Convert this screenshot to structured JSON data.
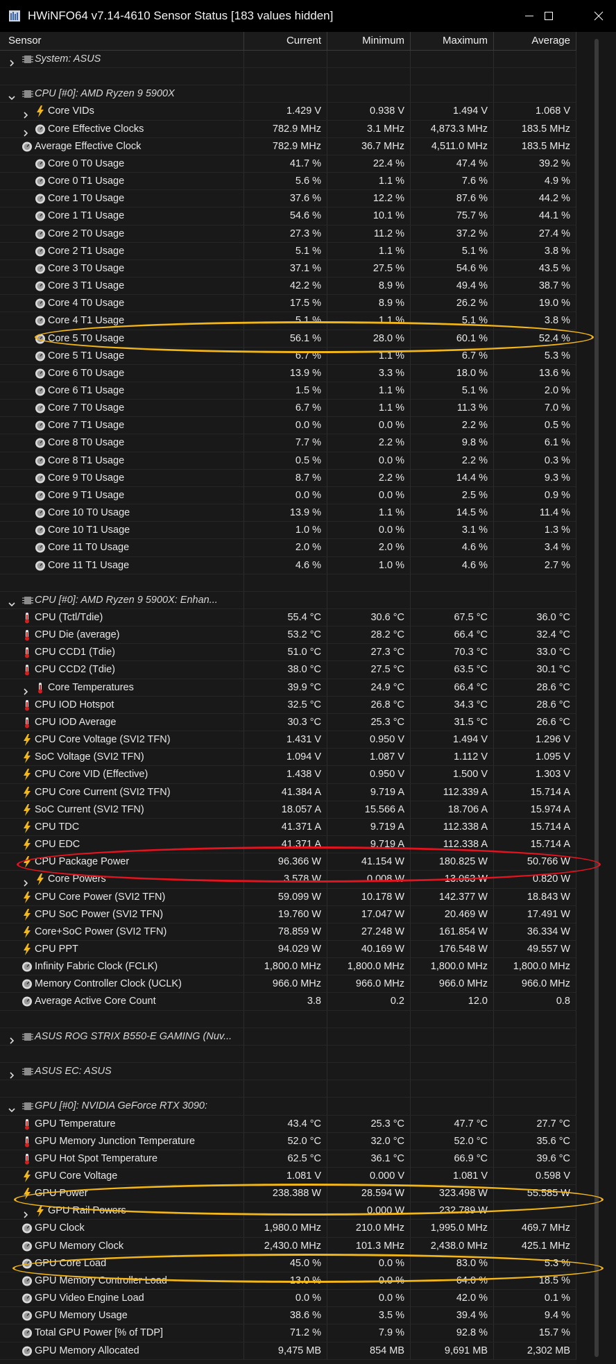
{
  "window": {
    "title": "HWiNFO64 v7.14-4610 Sensor Status [183 values hidden]"
  },
  "columns": {
    "sensor": "Sensor",
    "current": "Current",
    "minimum": "Minimum",
    "maximum": "Maximum",
    "average": "Average"
  },
  "colors": {
    "highlight_yellow": "#f2b61a",
    "highlight_red": "#e3141f"
  },
  "rows": [
    {
      "type": "group",
      "name": "System: ASUS",
      "icon": "chip-icon",
      "expander": "collapsed"
    },
    {
      "type": "spacer"
    },
    {
      "type": "group",
      "name": "CPU [#0]: AMD Ryzen 9 5900X",
      "icon": "chip-icon",
      "expander": "expanded"
    },
    {
      "type": "item",
      "indent": 1,
      "expander": "collapsed",
      "icon": "bolt-icon",
      "name": "Core VIDs",
      "current": "1.429 V",
      "minimum": "0.938 V",
      "maximum": "1.494 V",
      "average": "1.068 V"
    },
    {
      "type": "item",
      "indent": 1,
      "expander": "collapsed",
      "icon": "gauge-icon",
      "name": "Core Effective Clocks",
      "current": "782.9 MHz",
      "minimum": "3.1 MHz",
      "maximum": "4,873.3 MHz",
      "average": "183.5 MHz"
    },
    {
      "type": "item",
      "indent": 0,
      "icon": "gauge-icon",
      "name": "Average Effective Clock",
      "current": "782.9 MHz",
      "minimum": "36.7 MHz",
      "maximum": "4,511.0 MHz",
      "average": "183.5 MHz"
    },
    {
      "type": "item",
      "indent": 1,
      "icon": "gauge-icon",
      "name": "Core 0 T0 Usage",
      "current": "41.7 %",
      "minimum": "22.4 %",
      "maximum": "47.4 %",
      "average": "39.2 %"
    },
    {
      "type": "item",
      "indent": 1,
      "icon": "gauge-icon",
      "name": "Core 0 T1 Usage",
      "current": "5.6 %",
      "minimum": "1.1 %",
      "maximum": "7.6 %",
      "average": "4.9 %"
    },
    {
      "type": "item",
      "indent": 1,
      "icon": "gauge-icon",
      "name": "Core 1 T0 Usage",
      "current": "37.6 %",
      "minimum": "12.2 %",
      "maximum": "87.6 %",
      "average": "44.2 %"
    },
    {
      "type": "item",
      "indent": 1,
      "icon": "gauge-icon",
      "name": "Core 1 T1 Usage",
      "current": "54.6 %",
      "minimum": "10.1 %",
      "maximum": "75.7 %",
      "average": "44.1 %"
    },
    {
      "type": "item",
      "indent": 1,
      "icon": "gauge-icon",
      "name": "Core 2 T0 Usage",
      "current": "27.3 %",
      "minimum": "11.2 %",
      "maximum": "37.2 %",
      "average": "27.4 %"
    },
    {
      "type": "item",
      "indent": 1,
      "icon": "gauge-icon",
      "name": "Core 2 T1 Usage",
      "current": "5.1 %",
      "minimum": "1.1 %",
      "maximum": "5.1 %",
      "average": "3.8 %"
    },
    {
      "type": "item",
      "indent": 1,
      "icon": "gauge-icon",
      "name": "Core 3 T0 Usage",
      "current": "37.1 %",
      "minimum": "27.5 %",
      "maximum": "54.6 %",
      "average": "43.5 %"
    },
    {
      "type": "item",
      "indent": 1,
      "icon": "gauge-icon",
      "name": "Core 3 T1 Usage",
      "current": "42.2 %",
      "minimum": "8.9 %",
      "maximum": "49.4 %",
      "average": "38.7 %"
    },
    {
      "type": "item",
      "indent": 1,
      "icon": "gauge-icon",
      "name": "Core 4 T0 Usage",
      "current": "17.5 %",
      "minimum": "8.9 %",
      "maximum": "26.2 %",
      "average": "19.0 %"
    },
    {
      "type": "item",
      "indent": 1,
      "icon": "gauge-icon",
      "name": "Core 4 T1 Usage",
      "current": "5.1 %",
      "minimum": "1.1 %",
      "maximum": "5.1 %",
      "average": "3.8 %"
    },
    {
      "type": "item",
      "indent": 1,
      "icon": "gauge-icon",
      "name": "Core 5 T0 Usage",
      "current": "56.1 %",
      "minimum": "28.0 %",
      "maximum": "60.1 %",
      "average": "52.4 %"
    },
    {
      "type": "item",
      "indent": 1,
      "icon": "gauge-icon",
      "name": "Core 5 T1 Usage",
      "current": "6.7 %",
      "minimum": "1.1 %",
      "maximum": "6.7 %",
      "average": "5.3 %"
    },
    {
      "type": "item",
      "indent": 1,
      "icon": "gauge-icon",
      "name": "Core 6 T0 Usage",
      "current": "13.9 %",
      "minimum": "3.3 %",
      "maximum": "18.0 %",
      "average": "13.6 %"
    },
    {
      "type": "item",
      "indent": 1,
      "icon": "gauge-icon",
      "name": "Core 6 T1 Usage",
      "current": "1.5 %",
      "minimum": "1.1 %",
      "maximum": "5.1 %",
      "average": "2.0 %"
    },
    {
      "type": "item",
      "indent": 1,
      "icon": "gauge-icon",
      "name": "Core 7 T0 Usage",
      "current": "6.7 %",
      "minimum": "1.1 %",
      "maximum": "11.3 %",
      "average": "7.0 %"
    },
    {
      "type": "item",
      "indent": 1,
      "icon": "gauge-icon",
      "name": "Core 7 T1 Usage",
      "current": "0.0 %",
      "minimum": "0.0 %",
      "maximum": "2.2 %",
      "average": "0.5 %"
    },
    {
      "type": "item",
      "indent": 1,
      "icon": "gauge-icon",
      "name": "Core 8 T0 Usage",
      "current": "7.7 %",
      "minimum": "2.2 %",
      "maximum": "9.8 %",
      "average": "6.1 %"
    },
    {
      "type": "item",
      "indent": 1,
      "icon": "gauge-icon",
      "name": "Core 8 T1 Usage",
      "current": "0.5 %",
      "minimum": "0.0 %",
      "maximum": "2.2 %",
      "average": "0.3 %"
    },
    {
      "type": "item",
      "indent": 1,
      "icon": "gauge-icon",
      "name": "Core 9 T0 Usage",
      "current": "8.7 %",
      "minimum": "2.2 %",
      "maximum": "14.4 %",
      "average": "9.3 %"
    },
    {
      "type": "item",
      "indent": 1,
      "icon": "gauge-icon",
      "name": "Core 9 T1 Usage",
      "current": "0.0 %",
      "minimum": "0.0 %",
      "maximum": "2.5 %",
      "average": "0.9 %"
    },
    {
      "type": "item",
      "indent": 1,
      "icon": "gauge-icon",
      "name": "Core 10 T0 Usage",
      "current": "13.9 %",
      "minimum": "1.1 %",
      "maximum": "14.5 %",
      "average": "11.4 %"
    },
    {
      "type": "item",
      "indent": 1,
      "icon": "gauge-icon",
      "name": "Core 10 T1 Usage",
      "current": "1.0 %",
      "minimum": "0.0 %",
      "maximum": "3.1 %",
      "average": "1.3 %"
    },
    {
      "type": "item",
      "indent": 1,
      "icon": "gauge-icon",
      "name": "Core 11 T0 Usage",
      "current": "2.0 %",
      "minimum": "2.0 %",
      "maximum": "4.6 %",
      "average": "3.4 %"
    },
    {
      "type": "item",
      "indent": 1,
      "icon": "gauge-icon",
      "name": "Core 11 T1 Usage",
      "current": "4.6 %",
      "minimum": "1.0 %",
      "maximum": "4.6 %",
      "average": "2.7 %"
    },
    {
      "type": "spacer"
    },
    {
      "type": "group",
      "name": "CPU [#0]: AMD Ryzen 9 5900X: Enhan...",
      "icon": "chip-icon",
      "expander": "expanded"
    },
    {
      "type": "item",
      "indent": 0,
      "icon": "thermometer-icon",
      "name": "CPU (Tctl/Tdie)",
      "current": "55.4 °C",
      "minimum": "30.6 °C",
      "maximum": "67.5 °C",
      "average": "36.0 °C"
    },
    {
      "type": "item",
      "indent": 0,
      "icon": "thermometer-icon",
      "name": "CPU Die (average)",
      "current": "53.2 °C",
      "minimum": "28.2 °C",
      "maximum": "66.4 °C",
      "average": "32.4 °C"
    },
    {
      "type": "item",
      "indent": 0,
      "icon": "thermometer-icon",
      "name": "CPU CCD1 (Tdie)",
      "current": "51.0 °C",
      "minimum": "27.3 °C",
      "maximum": "70.3 °C",
      "average": "33.0 °C"
    },
    {
      "type": "item",
      "indent": 0,
      "icon": "thermometer-icon",
      "name": "CPU CCD2 (Tdie)",
      "current": "38.0 °C",
      "minimum": "27.5 °C",
      "maximum": "63.5 °C",
      "average": "30.1 °C"
    },
    {
      "type": "item",
      "indent": 1,
      "expander": "collapsed",
      "icon": "thermometer-icon",
      "name": "Core Temperatures",
      "current": "39.9 °C",
      "minimum": "24.9 °C",
      "maximum": "66.4 °C",
      "average": "28.6 °C"
    },
    {
      "type": "item",
      "indent": 0,
      "icon": "thermometer-icon",
      "name": "CPU IOD Hotspot",
      "current": "32.5 °C",
      "minimum": "26.8 °C",
      "maximum": "34.3 °C",
      "average": "28.6 °C"
    },
    {
      "type": "item",
      "indent": 0,
      "icon": "thermometer-icon",
      "name": "CPU IOD Average",
      "current": "30.3 °C",
      "minimum": "25.3 °C",
      "maximum": "31.5 °C",
      "average": "26.6 °C"
    },
    {
      "type": "item",
      "indent": 0,
      "icon": "bolt-icon",
      "name": "CPU Core Voltage (SVI2 TFN)",
      "current": "1.431 V",
      "minimum": "0.950 V",
      "maximum": "1.494 V",
      "average": "1.296 V"
    },
    {
      "type": "item",
      "indent": 0,
      "icon": "bolt-icon",
      "name": "SoC Voltage (SVI2 TFN)",
      "current": "1.094 V",
      "minimum": "1.087 V",
      "maximum": "1.112 V",
      "average": "1.095 V"
    },
    {
      "type": "item",
      "indent": 0,
      "icon": "bolt-icon",
      "name": "CPU Core VID (Effective)",
      "current": "1.438 V",
      "minimum": "0.950 V",
      "maximum": "1.500 V",
      "average": "1.303 V"
    },
    {
      "type": "item",
      "indent": 0,
      "icon": "bolt-icon",
      "name": "CPU Core Current (SVI2 TFN)",
      "current": "41.384 A",
      "minimum": "9.719 A",
      "maximum": "112.339 A",
      "average": "15.714 A"
    },
    {
      "type": "item",
      "indent": 0,
      "icon": "bolt-icon",
      "name": "SoC Current (SVI2 TFN)",
      "current": "18.057 A",
      "minimum": "15.566 A",
      "maximum": "18.706 A",
      "average": "15.974 A"
    },
    {
      "type": "item",
      "indent": 0,
      "icon": "bolt-icon",
      "name": "CPU TDC",
      "current": "41.371 A",
      "minimum": "9.719 A",
      "maximum": "112.338 A",
      "average": "15.714 A"
    },
    {
      "type": "item",
      "indent": 0,
      "icon": "bolt-icon",
      "name": "CPU EDC",
      "current": "41.371 A",
      "minimum": "9.719 A",
      "maximum": "112.338 A",
      "average": "15.714 A"
    },
    {
      "type": "item",
      "indent": 0,
      "icon": "bolt-icon",
      "name": "CPU Package Power",
      "current": "96.366 W",
      "minimum": "41.154 W",
      "maximum": "180.825 W",
      "average": "50.766 W"
    },
    {
      "type": "item",
      "indent": 1,
      "expander": "collapsed",
      "icon": "bolt-icon",
      "name": "Core Powers",
      "current": "3.578 W",
      "minimum": "0.008 W",
      "maximum": "13.063 W",
      "average": "0.820 W"
    },
    {
      "type": "item",
      "indent": 0,
      "icon": "bolt-icon",
      "name": "CPU Core Power (SVI2 TFN)",
      "current": "59.099 W",
      "minimum": "10.178 W",
      "maximum": "142.377 W",
      "average": "18.843 W"
    },
    {
      "type": "item",
      "indent": 0,
      "icon": "bolt-icon",
      "name": "CPU SoC Power (SVI2 TFN)",
      "current": "19.760 W",
      "minimum": "17.047 W",
      "maximum": "20.469 W",
      "average": "17.491 W"
    },
    {
      "type": "item",
      "indent": 0,
      "icon": "bolt-icon",
      "name": "Core+SoC Power (SVI2 TFN)",
      "current": "78.859 W",
      "minimum": "27.248 W",
      "maximum": "161.854 W",
      "average": "36.334 W"
    },
    {
      "type": "item",
      "indent": 0,
      "icon": "bolt-icon",
      "name": "CPU PPT",
      "current": "94.029 W",
      "minimum": "40.169 W",
      "maximum": "176.548 W",
      "average": "49.557 W"
    },
    {
      "type": "item",
      "indent": 0,
      "icon": "gauge-icon",
      "name": "Infinity Fabric Clock (FCLK)",
      "current": "1,800.0 MHz",
      "minimum": "1,800.0 MHz",
      "maximum": "1,800.0 MHz",
      "average": "1,800.0 MHz"
    },
    {
      "type": "item",
      "indent": 0,
      "icon": "gauge-icon",
      "name": "Memory Controller Clock (UCLK)",
      "current": "966.0 MHz",
      "minimum": "966.0 MHz",
      "maximum": "966.0 MHz",
      "average": "966.0 MHz"
    },
    {
      "type": "item",
      "indent": 0,
      "icon": "gauge-icon",
      "name": "Average Active Core Count",
      "current": "3.8",
      "minimum": "0.2",
      "maximum": "12.0",
      "average": "0.8"
    },
    {
      "type": "spacer"
    },
    {
      "type": "group",
      "name": "ASUS ROG STRIX B550-E GAMING (Nuv...",
      "icon": "chip-icon",
      "expander": "collapsed"
    },
    {
      "type": "spacer"
    },
    {
      "type": "group",
      "name": "ASUS EC: ASUS",
      "icon": "chip-icon",
      "expander": "collapsed"
    },
    {
      "type": "spacer"
    },
    {
      "type": "group",
      "name": "GPU [#0]: NVIDIA GeForce RTX 3090:",
      "icon": "chip-icon",
      "expander": "expanded"
    },
    {
      "type": "item",
      "indent": 0,
      "icon": "thermometer-icon",
      "name": "GPU Temperature",
      "current": "43.4 °C",
      "minimum": "25.3 °C",
      "maximum": "47.7 °C",
      "average": "27.7 °C"
    },
    {
      "type": "item",
      "indent": 0,
      "icon": "thermometer-icon",
      "name": "GPU Memory Junction Temperature",
      "current": "52.0 °C",
      "minimum": "32.0 °C",
      "maximum": "52.0 °C",
      "average": "35.6 °C"
    },
    {
      "type": "item",
      "indent": 0,
      "icon": "thermometer-icon",
      "name": "GPU Hot Spot Temperature",
      "current": "62.5 °C",
      "minimum": "36.1 °C",
      "maximum": "66.9 °C",
      "average": "39.6 °C"
    },
    {
      "type": "item",
      "indent": 0,
      "icon": "bolt-icon",
      "name": "GPU Core Voltage",
      "current": "1.081 V",
      "minimum": "0.000 V",
      "maximum": "1.081 V",
      "average": "0.598 V"
    },
    {
      "type": "item",
      "indent": 0,
      "icon": "bolt-icon",
      "name": "GPU Power",
      "current": "238.388 W",
      "minimum": "28.594 W",
      "maximum": "323.498 W",
      "average": "55.585 W"
    },
    {
      "type": "item",
      "indent": 1,
      "expander": "collapsed",
      "icon": "bolt-icon",
      "name": "GPU Rail Powers",
      "current": "",
      "minimum": "0.000 W",
      "maximum": "232.789 W",
      "average": ""
    },
    {
      "type": "item",
      "indent": 0,
      "icon": "gauge-icon",
      "name": "GPU Clock",
      "current": "1,980.0 MHz",
      "minimum": "210.0 MHz",
      "maximum": "1,995.0 MHz",
      "average": "469.7 MHz"
    },
    {
      "type": "item",
      "indent": 0,
      "icon": "gauge-icon",
      "name": "GPU Memory Clock",
      "current": "2,430.0 MHz",
      "minimum": "101.3 MHz",
      "maximum": "2,438.0 MHz",
      "average": "425.1 MHz"
    },
    {
      "type": "item",
      "indent": 0,
      "icon": "gauge-icon",
      "name": "GPU Core Load",
      "current": "45.0 %",
      "minimum": "0.0 %",
      "maximum": "83.0 %",
      "average": "5.3 %"
    },
    {
      "type": "item",
      "indent": 0,
      "icon": "gauge-icon",
      "name": "GPU Memory Controller Load",
      "current": "13.0 %",
      "minimum": "0.0 %",
      "maximum": "64.0 %",
      "average": "18.5 %"
    },
    {
      "type": "item",
      "indent": 0,
      "icon": "gauge-icon",
      "name": "GPU Video Engine Load",
      "current": "0.0 %",
      "minimum": "0.0 %",
      "maximum": "42.0 %",
      "average": "0.1 %"
    },
    {
      "type": "item",
      "indent": 0,
      "icon": "gauge-icon",
      "name": "GPU Memory Usage",
      "current": "38.6 %",
      "minimum": "3.5 %",
      "maximum": "39.4 %",
      "average": "9.4 %"
    },
    {
      "type": "item",
      "indent": 0,
      "icon": "gauge-icon",
      "name": "Total GPU Power [% of TDP]",
      "current": "71.2 %",
      "minimum": "7.9 %",
      "maximum": "92.8 %",
      "average": "15.7 %"
    },
    {
      "type": "item",
      "indent": 0,
      "icon": "gauge-icon",
      "name": "GPU Memory Allocated",
      "current": "9,475 MB",
      "minimum": "854 MB",
      "maximum": "9,691 MB",
      "average": "2,302 MB"
    }
  ]
}
